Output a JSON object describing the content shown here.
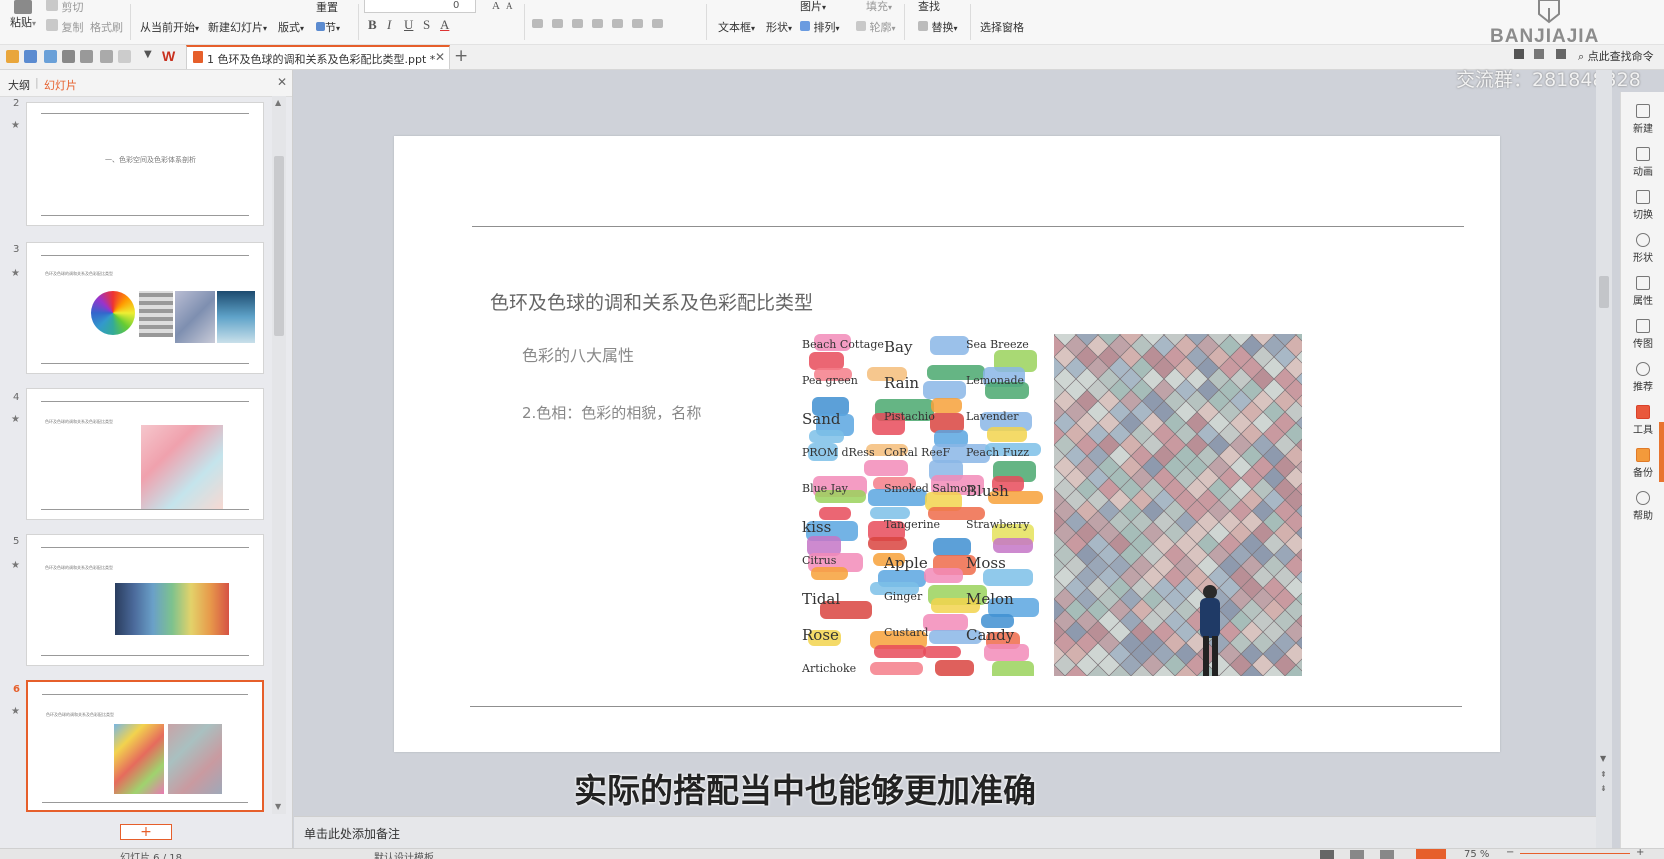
{
  "ribbon": {
    "paste": "粘贴",
    "cut": "剪切",
    "copy": "复制",
    "format_painter": "格式刷",
    "from_current": "从当前开始",
    "new_slide": "新建幻灯片",
    "layout": "版式",
    "section": "节",
    "reset": "重置",
    "font_size": "0",
    "text_box": "文本框",
    "shape": "形状",
    "arrange": "排列",
    "picture": "图片",
    "fill": "填充",
    "outline": "轮廓",
    "find": "查找",
    "replace": "替换",
    "selection_pane": "选择窗格"
  },
  "brand": {
    "logo": "BANJIAJIA",
    "search_cmd": "点此查找命令",
    "group_text": "交流群：281848328"
  },
  "tabbar": {
    "doc_tab": "1 色环及色球的调和关系及色彩配比类型.ppt *"
  },
  "left_panel": {
    "tab_outline": "大纲",
    "tab_slides": "幻灯片",
    "thumbs": [
      {
        "num": "2",
        "text": "一、色彩空间及色彩体系剖析"
      },
      {
        "num": "3",
        "text": "色环及色球的调和关系及色彩配比类型"
      },
      {
        "num": "4",
        "text": "色环及色球的调和关系及色彩配比类型"
      },
      {
        "num": "5",
        "text": "色环及色球的调和关系及色彩配比类型"
      },
      {
        "num": "6",
        "text": "色环及色球的调和关系及色彩配比类型"
      }
    ]
  },
  "slide": {
    "title": "色环及色球的调和关系及色彩配比类型",
    "subtitle": "色彩的八大属性",
    "point": "2.色相：色彩的相貌，名称"
  },
  "swatch_words": [
    "Beach Cottage",
    "Bay",
    "Sea Breeze",
    "Pea green",
    "Rain",
    "Lemonade",
    "Sand",
    "Pistachio",
    "Lavender",
    "PROM dRess",
    "CoRal ReeF",
    "Peach Fuzz",
    "Blue Jay",
    "Smoked Salmon",
    "Blush",
    "kiss",
    "Tangerine",
    "Strawberry",
    "Citrus",
    "Apple",
    "Moss",
    "Tidal",
    "Ginger",
    "Melon",
    "Rose",
    "Custard",
    "Candy",
    "Artichoke"
  ],
  "subtitle_caption": "实际的搭配当中也能够更加准确",
  "notes_placeholder": "单击此处添加备注",
  "right_tools": [
    "新建",
    "动画",
    "切换",
    "形状",
    "属性",
    "传图",
    "推荐",
    "工具",
    "备份",
    "帮助"
  ],
  "status": {
    "slide_count": "幻灯片 6 / 18",
    "template": "默认设计模板",
    "zoom": "75 %"
  },
  "colors": {
    "accent": "#e65f2b",
    "slide_bg": "#ffffff",
    "workspace": "#cfd2d9"
  }
}
